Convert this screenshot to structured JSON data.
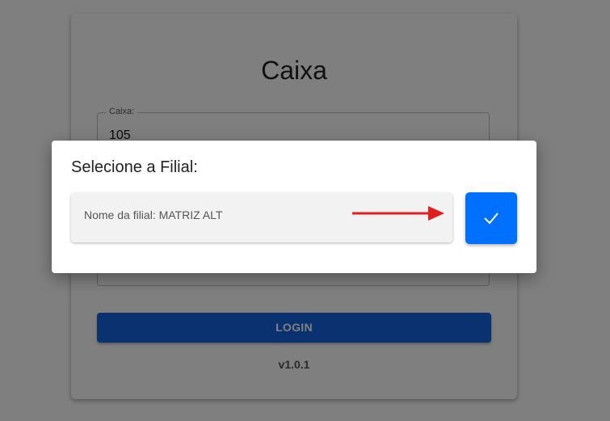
{
  "login_card": {
    "title": "Caixa",
    "caixa_label": "Caixa:",
    "caixa_value": "105",
    "login_label": "LOGIN",
    "version": "v1.0.1"
  },
  "dialog": {
    "title": "Selecione a Filial:",
    "filial_text": "Nome da filial: MATRIZ ALT",
    "confirm_icon": "check-icon",
    "annotation_icon": "red-arrow-icon"
  },
  "colors": {
    "primary": "#0070ff",
    "login_button": "#1565e0",
    "arrow": "#e02020",
    "overlay": "rgba(0,0,0,0.5)"
  }
}
